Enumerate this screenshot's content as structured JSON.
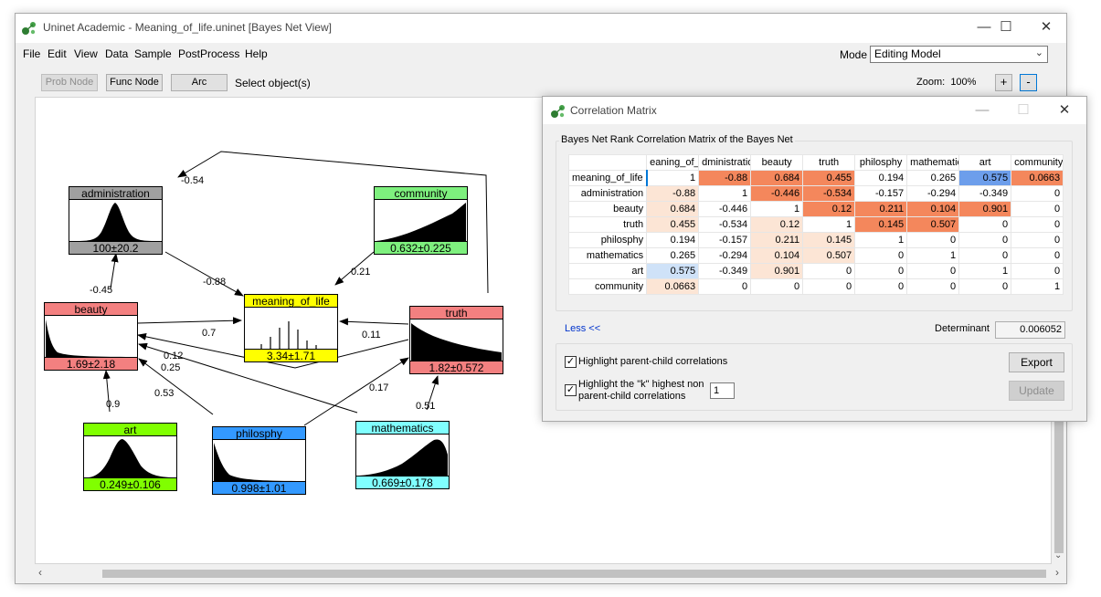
{
  "window": {
    "title": "Uninet Academic - Meaning_of_life.uninet  [Bayes Net View]",
    "minimize": "—",
    "maximize": "☐",
    "close": "✕"
  },
  "menu": [
    "File",
    "Edit",
    "View",
    "Data",
    "Sample",
    "PostProcess",
    "Help"
  ],
  "mode": {
    "label": "Mode",
    "value": "Editing Model"
  },
  "toolbar": {
    "prob_node": "Prob Node",
    "func_node": "Func Node",
    "arc": "Arc",
    "status": "Select object(s)",
    "zoom_label": "Zoom:",
    "zoom_value": "100%",
    "zoom_in": "+",
    "zoom_out": "-"
  },
  "nodes": {
    "administration": {
      "name": "administration",
      "value": "100±20.2",
      "color": "#a0a0a0"
    },
    "community": {
      "name": "community",
      "value": "0.632±0.225",
      "color": "#7ef07e"
    },
    "meaning_of_life": {
      "name": "meaning_of_life",
      "value": "3.34±1.71",
      "color": "#ffff00"
    },
    "beauty": {
      "name": "beauty",
      "value": "1.69±2.18",
      "color": "#f38080"
    },
    "truth": {
      "name": "truth",
      "value": "1.82±0.572",
      "color": "#f38080"
    },
    "art": {
      "name": "art",
      "value": "0.249±0.106",
      "color": "#80ff00"
    },
    "philosphy": {
      "name": "philosphy",
      "value": "0.998±1.01",
      "color": "#3399ff"
    },
    "mathematics": {
      "name": "mathematics",
      "value": "0.669±0.178",
      "color": "#80ffff"
    }
  },
  "arc_labels": {
    "admin_meaning": "-0.88",
    "truth_admin": "-0.54",
    "beauty_admin": "-0.45",
    "community_meaning": "0.21",
    "beauty_meaning": "0.7",
    "truth_meaning": "0.11",
    "truth_beauty": "0.12",
    "math_beauty": "0.25",
    "philo_beauty": "0.53",
    "art_beauty": "0.9",
    "philo_truth": "0.17",
    "math_truth": "0.51"
  },
  "corr": {
    "title": "Correlation Matrix",
    "group_label": "Bayes Net Rank Correlation Matrix of the Bayes Net",
    "columns": [
      "eaning_of_l",
      "dministratio",
      "beauty",
      "truth",
      "philosphy",
      "mathematics",
      "art",
      "community"
    ],
    "rows": [
      {
        "name": "meaning_of_life",
        "cells": [
          "1",
          "-0.88",
          "0.684",
          "0.455",
          "0.194",
          "0.265",
          "0.575",
          "0.0663"
        ]
      },
      {
        "name": "administration",
        "cells": [
          "-0.88",
          "1",
          "-0.446",
          "-0.534",
          "-0.157",
          "-0.294",
          "-0.349",
          "0"
        ]
      },
      {
        "name": "beauty",
        "cells": [
          "0.684",
          "-0.446",
          "1",
          "0.12",
          "0.211",
          "0.104",
          "0.901",
          "0"
        ]
      },
      {
        "name": "truth",
        "cells": [
          "0.455",
          "-0.534",
          "0.12",
          "1",
          "0.145",
          "0.507",
          "0",
          "0"
        ]
      },
      {
        "name": "philosphy",
        "cells": [
          "0.194",
          "-0.157",
          "0.211",
          "0.145",
          "1",
          "0",
          "0",
          "0"
        ]
      },
      {
        "name": "mathematics",
        "cells": [
          "0.265",
          "-0.294",
          "0.104",
          "0.507",
          "0",
          "1",
          "0",
          "0"
        ]
      },
      {
        "name": "art",
        "cells": [
          "0.575",
          "-0.349",
          "0.901",
          "0",
          "0",
          "0",
          "1",
          "0"
        ]
      },
      {
        "name": "community",
        "cells": [
          "0.0663",
          "0",
          "0",
          "0",
          "0",
          "0",
          "0",
          "1"
        ]
      }
    ],
    "highlight": [
      [
        "",
        "#f4875c",
        "#f4875c",
        "#f4875c",
        "",
        "",
        "#6d9eeb",
        "#f4875c"
      ],
      [
        "#fce5d5",
        "",
        "#f4875c",
        "#f4875c",
        "",
        "",
        "",
        ""
      ],
      [
        "#fce5d5",
        "",
        "",
        "#f4875c",
        "#f4875c",
        "#f4875c",
        "#f4875c",
        ""
      ],
      [
        "#fce5d5",
        "",
        "#fce5d5",
        "",
        "#f4875c",
        "#f4875c",
        "",
        ""
      ],
      [
        "",
        "",
        "#fce5d5",
        "#fce5d5",
        "",
        "",
        "",
        ""
      ],
      [
        "",
        "",
        "#fce5d5",
        "#fce5d5",
        "",
        "",
        "",
        ""
      ],
      [
        "#cfe2f8",
        "",
        "#fce5d5",
        "",
        "",
        "",
        "",
        ""
      ],
      [
        "#fce5d5",
        "",
        "",
        "",
        "",
        "",
        "",
        ""
      ]
    ],
    "less": "Less <<",
    "determinant_label": "Determinant",
    "determinant_value": "0.006052",
    "opt_parent_child": "Highlight parent-child correlations",
    "opt_k_line1": "Highlight the \"k\" highest non",
    "opt_k_line2": "parent-child correlations",
    "k_value": "1",
    "export": "Export",
    "update": "Update"
  }
}
